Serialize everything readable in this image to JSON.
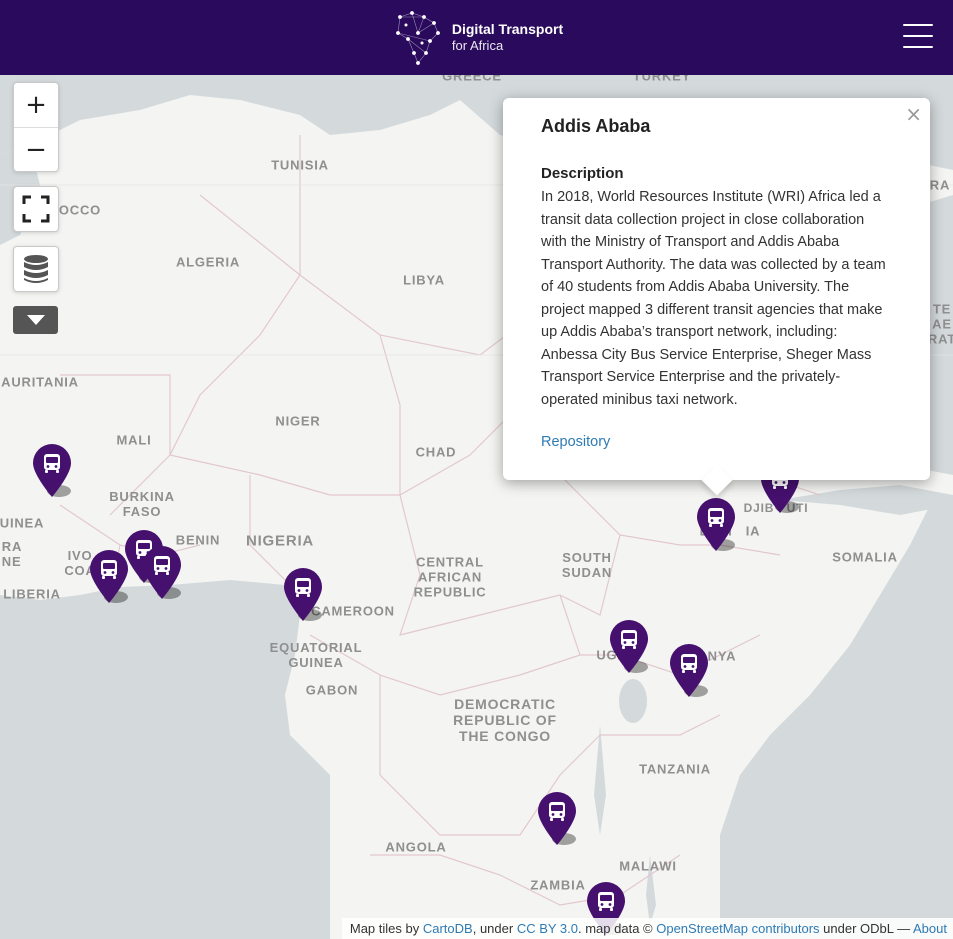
{
  "header": {
    "brand_line1": "Digital Transport",
    "brand_line2": "for Africa"
  },
  "map": {
    "water_color": "#d4dadc",
    "land_color": "#f4f4f2",
    "marker_color": "#45106e",
    "places": {
      "greece": "GREECE",
      "turkey": "TURKEY",
      "tunisia": "TUNISIA",
      "morocco": "OCCO",
      "algeria": "ALGERIA",
      "libya": "LIBYA",
      "mauritania": "AURITANIA",
      "mali": "MALI",
      "niger": "NIGER",
      "chad": "CHAD",
      "burkina": "BURKINA\nFASO",
      "benin": "BENIN",
      "nigeria": "NIGERIA",
      "guinea": "UINEA",
      "sierra": "RA\nNE",
      "ivory": "IVO\nCOA",
      "liberia": "LIBERIA",
      "car": "CENTRAL\nAFRICAN\nREPUBLIC",
      "south_sudan": "SOUTH\nSUDAN",
      "cameroon": "CAMEROON",
      "eq_guinea": "EQUATORIAL\nGUINEA",
      "gabon": "GABON",
      "drc": "DEMOCRATIC\nREPUBLIC OF\nTHE CONGO",
      "uganda": "UGA",
      "kenya": "NYA",
      "ethiopia": "ETHI   IA",
      "djibouti": "DJIB   UTI",
      "somalia": "SOMALIA",
      "tanzania": "TANZANIA",
      "angola": "ANGOLA",
      "malawi": "MALAWI",
      "zambia": "ZAMBIA",
      "saudi_partial": "RA",
      "yemen_partial": "TE\nAE\nRAT"
    }
  },
  "controls": {
    "zoom_in": "+",
    "zoom_out": "−"
  },
  "popup": {
    "title": "Addis Ababa",
    "subtitle": "Description",
    "description": "In 2018, World Resources Institute (WRI) Africa led a transit data collection project in close collaboration with the Ministry of Transport and Addis Ababa Transport Authority. The data was collected by a team of 40 students from Addis Ababa University. The project mapped 3 different transit agencies that make up Addis Ababa’s transport network, including: Anbessa City Bus Service Enterprise, Sheger Mass Transport Service Enterprise and the privately-operated minibus taxi network.",
    "link": "Repository",
    "close": "×"
  },
  "attribution": {
    "t1": "Map tiles by ",
    "cartodb": "CartoDB",
    "t2": ", under ",
    "ccby": "CC BY 3.0",
    "t3": ". map data © ",
    "osm": "OpenStreetMap contributors",
    "t4": " under ODbL",
    "t5": " — ",
    "about": "About"
  }
}
